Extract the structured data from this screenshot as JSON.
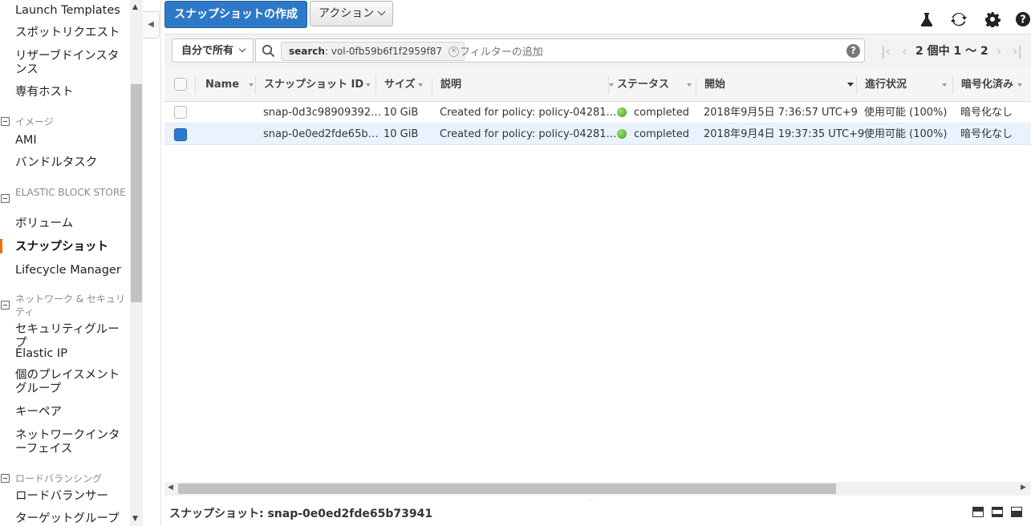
{
  "sidebar": {
    "items_top": [
      "Launch Templates",
      "スポットリクエスト",
      "リザーブドインスタンス",
      "専有ホスト"
    ],
    "sections": [
      {
        "title": "イメージ",
        "items": [
          "AMI",
          "バンドルタスク"
        ]
      },
      {
        "title": "ELASTIC BLOCK STORE",
        "items": [
          "ボリューム",
          "スナップショット",
          "Lifecycle Manager"
        ]
      },
      {
        "title": "ネットワーク & セキュリティ",
        "items": [
          "セキュリティグループ",
          "Elastic IP",
          "個のプレイスメントグループ",
          "キーペア",
          "ネットワークインターフェイス"
        ]
      },
      {
        "title": "ロードバランシング",
        "items": [
          "ロードバランサー",
          "ターゲットグループ"
        ]
      }
    ],
    "active_item": "スナップショット"
  },
  "toolbar": {
    "create_label": "スナップショットの作成",
    "actions_label": "アクション",
    "icons": [
      "flask-icon",
      "refresh-icon",
      "gear-icon",
      "help-icon"
    ]
  },
  "filter": {
    "owner_label": "自分で所有",
    "token_key": "search",
    "token_value": ": vol-0fb59b6f1f2959f87",
    "placeholder": "フィルターの追加",
    "help": "?"
  },
  "pagination": {
    "label": "2 個中 1 ～ 2"
  },
  "table": {
    "columns": [
      "Name",
      "スナップショット ID",
      "サイズ",
      "説明",
      "ステータス",
      "開始",
      "進行状況",
      "暗号化済み"
    ],
    "rows": [
      {
        "name": "",
        "snapshot_id": "snap-0d3c98909392…",
        "size": "10 GiB",
        "description": "Created for policy: policy-04281…",
        "status": "completed",
        "started": "2018年9月5日 7:36:57 UTC+9",
        "progress": "使用可能 (100%)",
        "encrypted": "暗号化なし",
        "selected": false
      },
      {
        "name": "",
        "snapshot_id": "snap-0e0ed2fde65b…",
        "size": "10 GiB",
        "description": "Created for policy: policy-04281…",
        "status": "completed",
        "started": "2018年9月4日 19:37:35 UTC+9",
        "progress": "使用可能 (100%)",
        "encrypted": "暗号化なし",
        "selected": true
      }
    ]
  },
  "detail": {
    "title": "スナップショット: snap-0e0ed2fde65b73941"
  },
  "colors": {
    "primary": "#2e79c7",
    "active_marker": "#ec7211",
    "status_ok": "#3d9e1f",
    "selected_row": "#eaf3fd"
  }
}
